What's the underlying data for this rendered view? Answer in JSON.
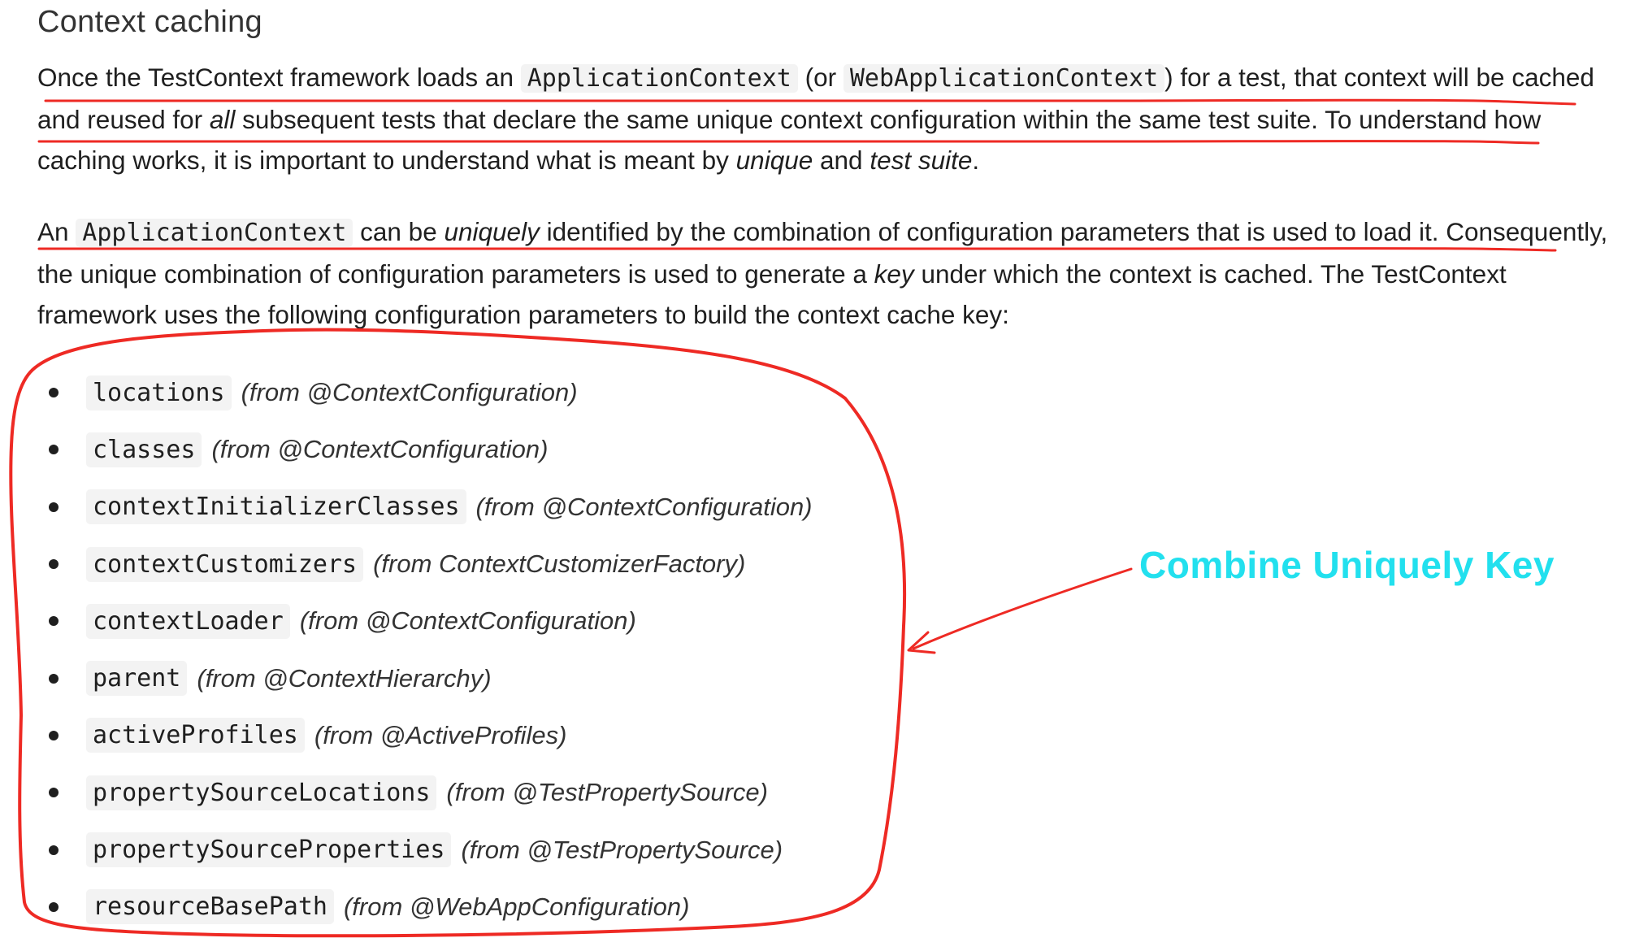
{
  "heading": "Context caching",
  "paragraph1": {
    "t1": "Once the TestContext framework loads an ",
    "code1": "ApplicationContext",
    "t2": " (or ",
    "code2": "WebApplicationContext",
    "t3": ") for a test, that context will be cached and reused for ",
    "em1": "all",
    "t4": " subsequent tests that declare the same unique context configuration within the same test suite. To understand how caching works, it is important to understand what is meant by ",
    "em2": "unique",
    "t5": " and ",
    "em3": "test suite",
    "t6": "."
  },
  "paragraph2": {
    "t1": "An ",
    "code1": "ApplicationContext",
    "t2": " can be ",
    "em1": "uniquely",
    "t3": " identified by the combination of configuration parameters that is used to load it. Consequently, the unique combination of configuration parameters is used to generate a ",
    "em2": "key",
    "t4": " under which the context is cached. The TestContext framework uses the following configuration parameters to build the context cache key:"
  },
  "parameters": [
    {
      "name": "locations",
      "source": "(from @ContextConfiguration)"
    },
    {
      "name": "classes",
      "source": "(from @ContextConfiguration)"
    },
    {
      "name": "contextInitializerClasses",
      "source": "(from @ContextConfiguration)"
    },
    {
      "name": "contextCustomizers",
      "source": "(from ContextCustomizerFactory)"
    },
    {
      "name": "contextLoader",
      "source": "(from @ContextConfiguration)"
    },
    {
      "name": "parent",
      "source": "(from @ContextHierarchy)"
    },
    {
      "name": "activeProfiles",
      "source": "(from @ActiveProfiles)"
    },
    {
      "name": "propertySourceLocations",
      "source": "(from @TestPropertySource)"
    },
    {
      "name": "propertySourceProperties",
      "source": "(from @TestPropertySource)"
    },
    {
      "name": "resourceBasePath",
      "source": "(from @WebAppConfiguration)"
    }
  ],
  "annotation": {
    "label": "Combine Uniquely Key",
    "label_color": "#22e0ee",
    "marker_color": "#ee2a24"
  }
}
